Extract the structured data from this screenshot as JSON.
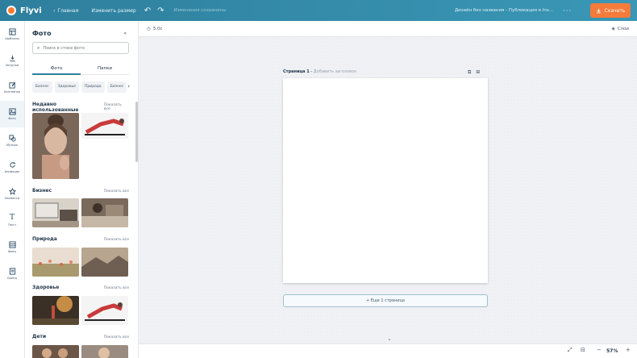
{
  "topbar": {
    "logo_text": "Flyvi",
    "home_label": "Главная",
    "resize_label": "Изменить размер",
    "changes_text": "Изменения сохранены",
    "doc_name": "Дизайн без названия - Публикация в Ins...",
    "download_label": "Скачать"
  },
  "rail": {
    "items": [
      {
        "label": "Шаблоны",
        "icon": "templates-icon"
      },
      {
        "label": "Загрузки",
        "icon": "upload-icon"
      },
      {
        "label": "Контейнер",
        "icon": "edit-icon"
      },
      {
        "label": "Фото",
        "icon": "photo-icon"
      },
      {
        "label": "Музыка",
        "icon": "shapes-icon"
      },
      {
        "label": "Анимация",
        "icon": "animation-icon"
      },
      {
        "label": "Элементы",
        "icon": "star-icon"
      },
      {
        "label": "Текст",
        "icon": "text-icon"
      },
      {
        "label": "Фоны",
        "icon": "backgrounds-icon"
      },
      {
        "label": "Бренд",
        "icon": "brand-icon"
      }
    ]
  },
  "panel": {
    "title": "Фото",
    "search_placeholder": "Поиск в стоке фото",
    "tabs": [
      "Фото",
      "Папки"
    ],
    "chips": [
      "Бизнес",
      "Здоровье",
      "Природа",
      "Бизнес"
    ],
    "sections": [
      {
        "title": "Недавно использованные",
        "link": "Показать все"
      },
      {
        "title": "Бизнес",
        "link": "Показать все"
      },
      {
        "title": "Природа",
        "link": "Показать все"
      },
      {
        "title": "Здоровье",
        "link": "Показать все"
      },
      {
        "title": "Дети",
        "link": "Показать все"
      }
    ]
  },
  "canvas": {
    "timer": "5.0с",
    "layers": "Слои",
    "page_label": "Страница 1",
    "page_label_sep": " - ",
    "page_add_title": "Добавить заголовок",
    "add_page": "+ Еще 1 страница",
    "zoom": "57%"
  },
  "colors": {
    "topbar": "#2e7f9d",
    "accent": "#f47b3a"
  }
}
